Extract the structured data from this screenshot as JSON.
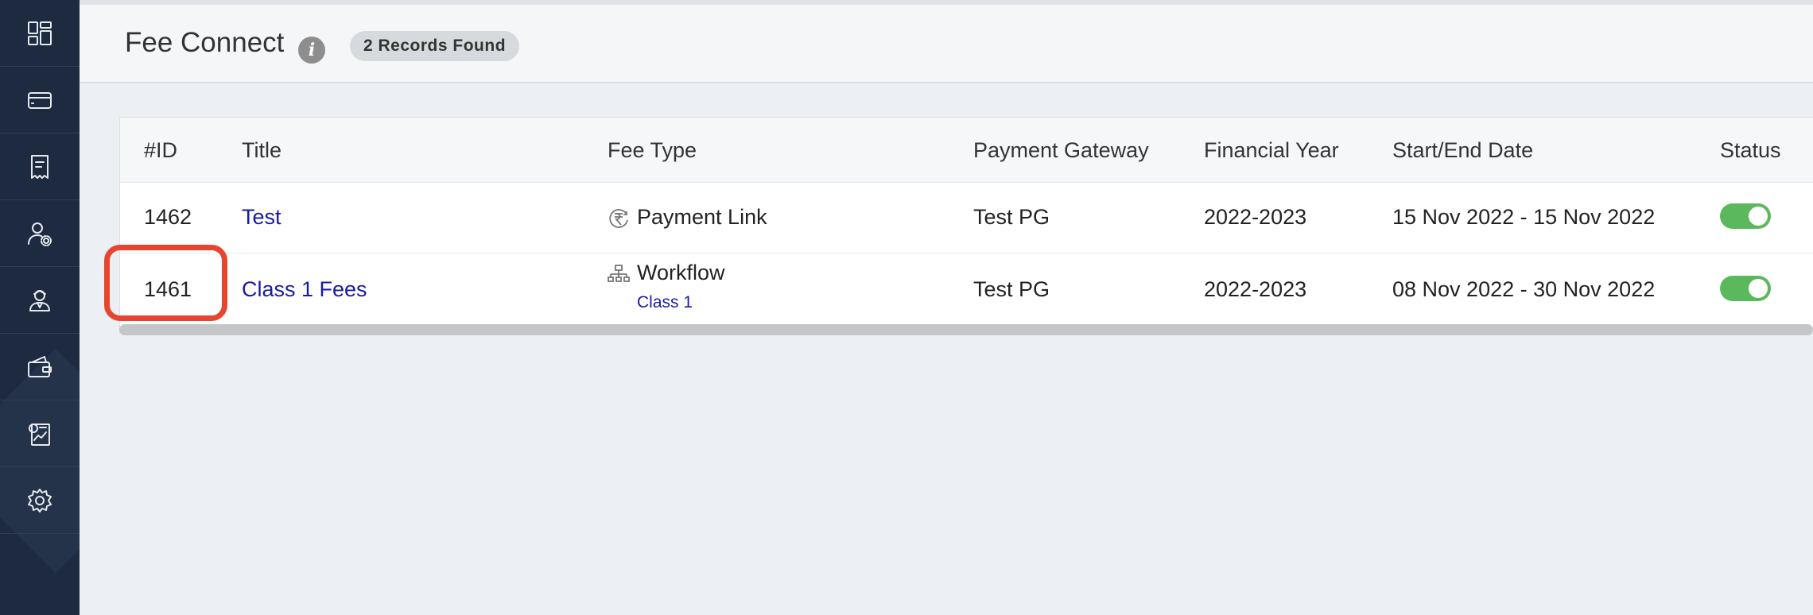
{
  "sidebar": {
    "items": [
      {
        "icon": "dashboard-icon"
      },
      {
        "icon": "card-icon"
      },
      {
        "icon": "receipt-icon"
      },
      {
        "icon": "user-settings-icon"
      },
      {
        "icon": "student-icon"
      },
      {
        "icon": "wallet-icon"
      },
      {
        "icon": "report-icon"
      },
      {
        "icon": "gear-icon"
      }
    ]
  },
  "header": {
    "title": "Fee Connect",
    "info_glyph": "i",
    "badge": "2 Records Found"
  },
  "table": {
    "columns": [
      "#ID",
      "Title",
      "Fee Type",
      "Payment Gateway",
      "Financial Year",
      "Start/End Date",
      "Status"
    ],
    "rows": [
      {
        "id": "1462",
        "title": "Test",
        "fee_type": "Payment Link",
        "fee_sub": "",
        "gateway": "Test PG",
        "year": "2022-2023",
        "dates": "15 Nov 2022 - 15 Nov 2022",
        "status_on": true
      },
      {
        "id": "1461",
        "title": "Class 1 Fees",
        "fee_type": "Workflow",
        "fee_sub": "Class 1",
        "gateway": "Test PG",
        "year": "2022-2023",
        "dates": "08 Nov 2022 - 30 Nov 2022",
        "status_on": true
      }
    ]
  },
  "colors": {
    "sidebar_bg": "#1d2a3f",
    "link": "#1a1aa6",
    "toggle_on": "#5cb85c",
    "highlight": "#e8452e"
  }
}
